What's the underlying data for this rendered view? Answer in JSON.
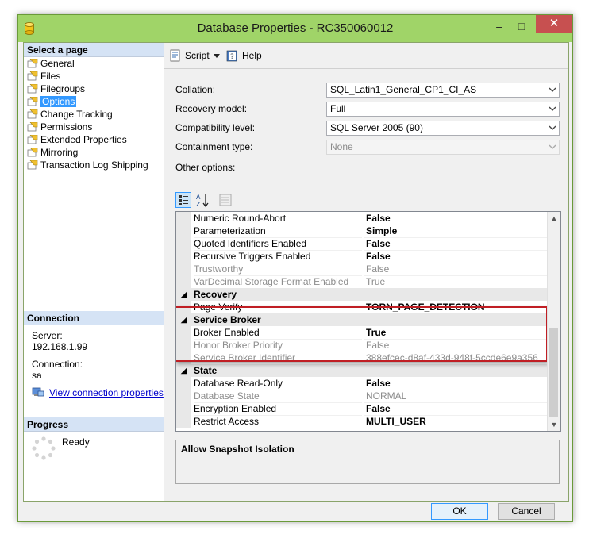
{
  "window": {
    "title": "Database Properties - RC350060012",
    "minimize_glyph": "–",
    "maximize_glyph": "□",
    "close_glyph": "✕"
  },
  "left_pane": {
    "select_page_header": "Select a page",
    "pages": [
      {
        "label": "General",
        "selected": false
      },
      {
        "label": "Files",
        "selected": false
      },
      {
        "label": "Filegroups",
        "selected": false
      },
      {
        "label": "Options",
        "selected": true
      },
      {
        "label": "Change Tracking",
        "selected": false
      },
      {
        "label": "Permissions",
        "selected": false
      },
      {
        "label": "Extended Properties",
        "selected": false
      },
      {
        "label": "Mirroring",
        "selected": false
      },
      {
        "label": "Transaction Log Shipping",
        "selected": false
      }
    ],
    "connection_header": "Connection",
    "server_label": "Server:",
    "server_value": "192.168.1.99",
    "connection_label": "Connection:",
    "connection_value": "sa",
    "view_connection_link": "View connection properties",
    "progress_header": "Progress",
    "progress_status": "Ready"
  },
  "toolbar": {
    "script_label": "Script",
    "help_label": "Help"
  },
  "form": {
    "collation_label": "Collation:",
    "collation_value": "SQL_Latin1_General_CP1_CI_AS",
    "recovery_label": "Recovery model:",
    "recovery_value": "Full",
    "compat_label": "Compatibility level:",
    "compat_value": "SQL Server 2005 (90)",
    "containment_label": "Containment type:",
    "containment_value": "None",
    "other_options_label": "Other options:"
  },
  "grid_rows": [
    {
      "type": "prop",
      "name": "Numeric Round-Abort",
      "value": "False",
      "bold": true,
      "disabled": false
    },
    {
      "type": "prop",
      "name": "Parameterization",
      "value": "Simple",
      "bold": true,
      "disabled": false
    },
    {
      "type": "prop",
      "name": "Quoted Identifiers Enabled",
      "value": "False",
      "bold": true,
      "disabled": false
    },
    {
      "type": "prop",
      "name": "Recursive Triggers Enabled",
      "value": "False",
      "bold": true,
      "disabled": false
    },
    {
      "type": "prop",
      "name": "Trustworthy",
      "value": "False",
      "bold": false,
      "disabled": true
    },
    {
      "type": "prop",
      "name": "VarDecimal Storage Format Enabled",
      "value": "True",
      "bold": false,
      "disabled": true
    },
    {
      "type": "cat",
      "name": "Recovery"
    },
    {
      "type": "prop",
      "name": "Page Verify",
      "value": "TORN_PAGE_DETECTION",
      "bold": true,
      "disabled": false
    },
    {
      "type": "cat",
      "name": "Service Broker"
    },
    {
      "type": "prop",
      "name": "Broker Enabled",
      "value": "True",
      "bold": true,
      "disabled": false
    },
    {
      "type": "prop",
      "name": "Honor Broker Priority",
      "value": "False",
      "bold": false,
      "disabled": true
    },
    {
      "type": "prop",
      "name": "Service Broker Identifier",
      "value": "388efcec-d8af-433d-948f-5ccde6e9a356",
      "bold": false,
      "disabled": true
    },
    {
      "type": "cat",
      "name": "State"
    },
    {
      "type": "prop",
      "name": "Database Read-Only",
      "value": "False",
      "bold": true,
      "disabled": false
    },
    {
      "type": "prop",
      "name": "Database State",
      "value": "NORMAL",
      "bold": false,
      "disabled": true
    },
    {
      "type": "prop",
      "name": "Encryption Enabled",
      "value": "False",
      "bold": true,
      "disabled": false
    },
    {
      "type": "prop",
      "name": "Restrict Access",
      "value": "MULTI_USER",
      "bold": true,
      "disabled": false
    }
  ],
  "description": {
    "title": "Allow Snapshot Isolation"
  },
  "footer": {
    "ok_label": "OK",
    "cancel_label": "Cancel"
  },
  "colors": {
    "titlebar": "#a0d468",
    "close": "#c75050",
    "highlight": "#c01e24",
    "selection": "#3399ff"
  }
}
